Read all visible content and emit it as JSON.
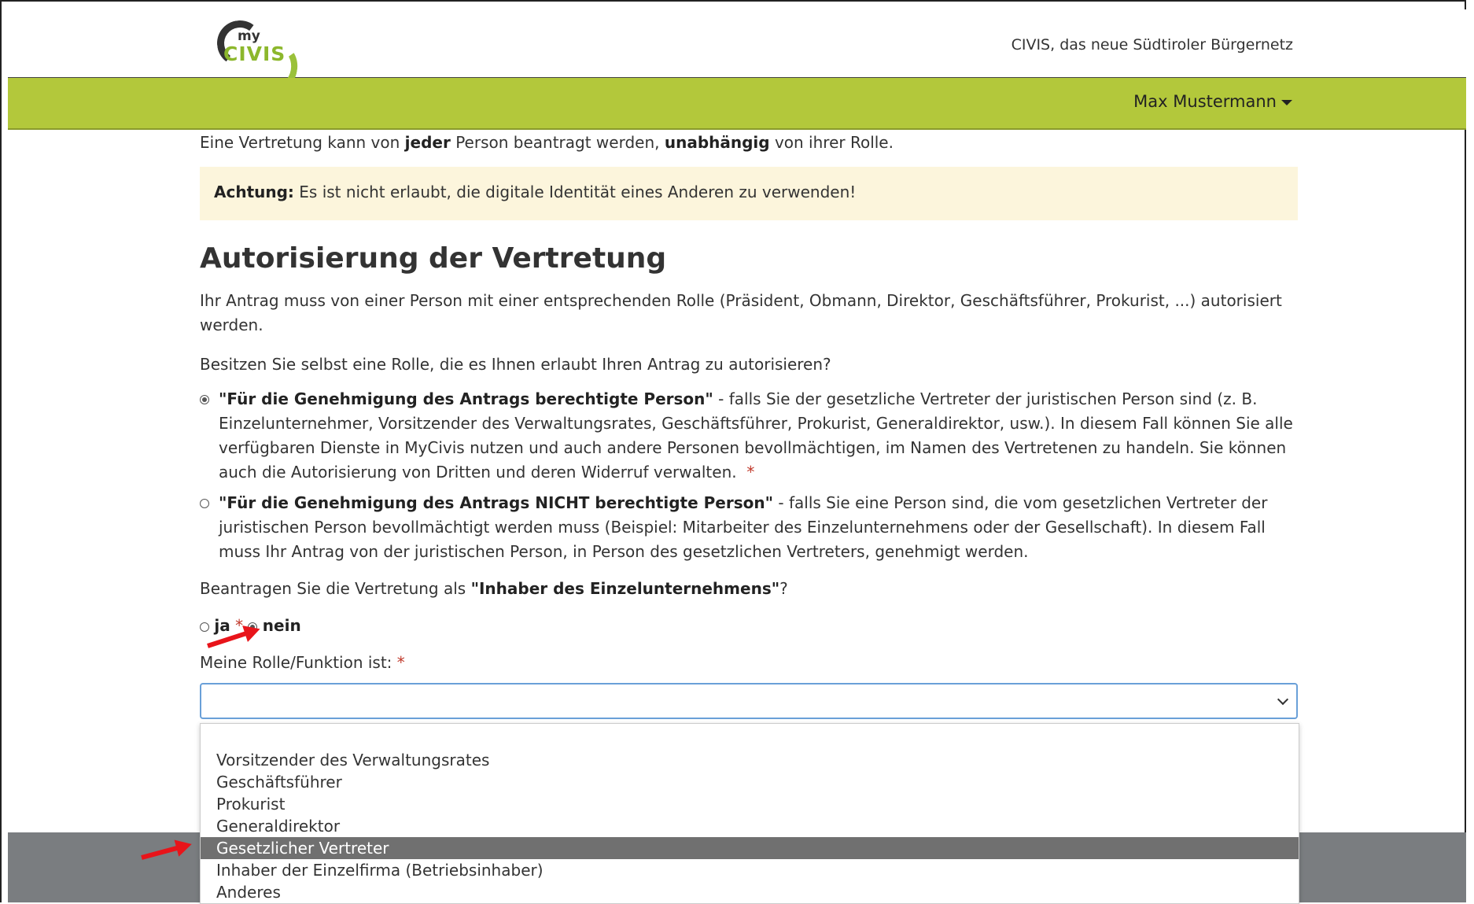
{
  "header": {
    "logo_text_my": "my",
    "logo_text_civis": "CIVIS",
    "tagline": "CIVIS, das neue Südtiroler Bürgernetz"
  },
  "nav": {
    "user_name": "Max Mustermann"
  },
  "intro": {
    "part1": "Eine Vertretung kann von ",
    "bold1": "jeder",
    "part2": " Person beantragt werden, ",
    "bold2": "unabhängig",
    "part3": " von ihrer Rolle."
  },
  "alert": {
    "label": "Achtung:",
    "text": " Es ist nicht erlaubt, die digitale Identität eines Anderen zu verwenden!"
  },
  "section": {
    "title": "Autorisierung der Vertretung",
    "description": "Ihr Antrag muss von einer Person mit einer entsprechenden Rolle (Präsident, Obmann, Direktor, Geschäftsführer, Prokurist, ...) autorisiert werden.",
    "question": "Besitzen Sie selbst eine Rolle, die es Ihnen erlaubt Ihren Antrag zu autorisieren?"
  },
  "authorization_options": [
    {
      "title": "\"Für die Genehmigung des Antrags berechtigte Person\"",
      "text": " - falls Sie der gesetzliche Vertreter der juristischen Person sind (z. B. Einzelunternehmer, Vorsitzender des Verwaltungsrates, Geschäftsführer, Prokurist, Generaldirektor, usw.). In diesem Fall können Sie alle verfügbaren Dienste in MyCivis nutzen und auch andere Personen bevollmächtigen, im Namen des Vertretenen zu handeln. Sie können auch die Autorisierung von Dritten und deren Widerruf verwalten.",
      "required_mark": "*",
      "selected": true
    },
    {
      "title": "\"Für die Genehmigung des Antrags NICHT berechtigte Person\"",
      "text": " - falls Sie eine Person sind, die vom gesetzlichen Vertreter der juristischen Person bevollmächtigt werden muss (Beispiel: Mitarbeiter des Einzelunternehmens oder der Gesellschaft). In diesem Fall muss Ihr Antrag von der juristischen Person, in Person des gesetzlichen Vertreters, genehmigt werden.",
      "selected": false
    }
  ],
  "owner_question": {
    "prefix": "Beantragen Sie die Vertretung als ",
    "bold": "\"Inhaber des Einzelunternehmens\"",
    "suffix": "?",
    "option_yes": "ja",
    "option_no": "nein",
    "required_mark": "*",
    "selected": "nein"
  },
  "role_field": {
    "label": "Meine Rolle/Funktion ist:",
    "required_mark": "*",
    "value": ""
  },
  "role_options": [
    "Vorsitzender des Verwaltungsrates",
    "Geschäftsführer",
    "Prokurist",
    "Generaldirektor",
    "Gesetzlicher Vertreter",
    "Inhaber der Einzelfirma (Betriebsinhaber)",
    "Anderes"
  ],
  "role_highlighted": "Gesetzlicher Vertreter",
  "colors": {
    "green_bar": "#b3c83b",
    "alert_bg": "#fcf5dc",
    "selected_option": "#707070",
    "annotation_arrow": "#e8141a",
    "required": "#c0392b"
  }
}
